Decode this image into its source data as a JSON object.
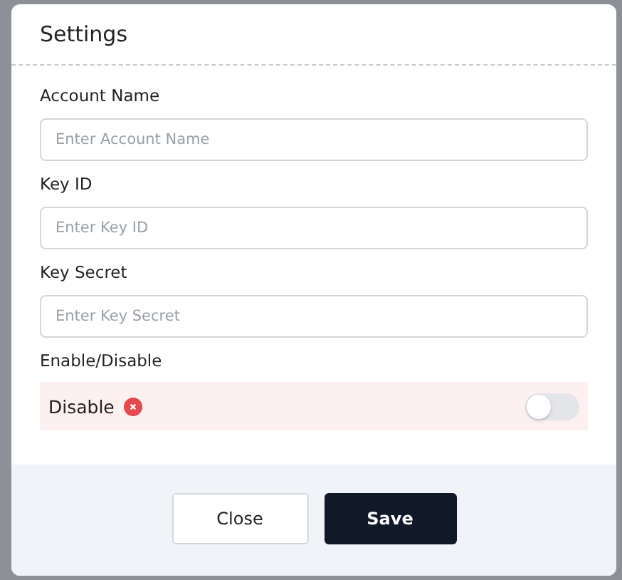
{
  "dialog": {
    "title": "Settings",
    "fields": [
      {
        "label": "Account Name",
        "placeholder": "Enter Account Name"
      },
      {
        "label": "Key ID",
        "placeholder": "Enter Key ID"
      },
      {
        "label": "Key Secret",
        "placeholder": "Enter Key Secret"
      }
    ],
    "toggle": {
      "label": "Enable/Disable",
      "status": "Disable",
      "on": false
    },
    "buttons": [
      {
        "label": "Close",
        "kind": "secondary"
      },
      {
        "label": "Save",
        "kind": "primary"
      }
    ]
  }
}
